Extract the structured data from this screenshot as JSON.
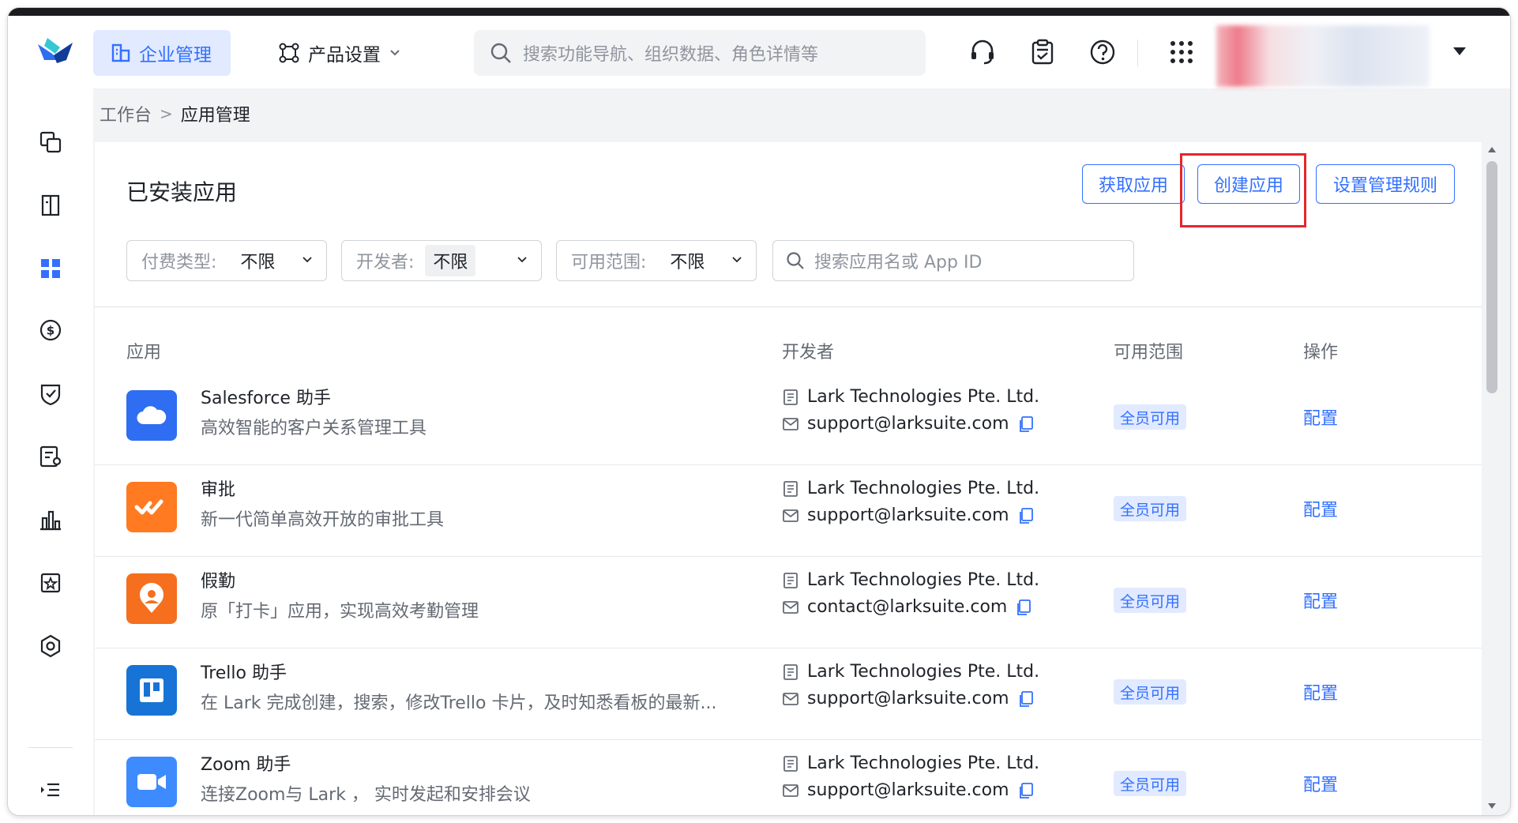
{
  "header": {
    "nav_corp": "企业管理",
    "nav_product": "产品设置",
    "search_placeholder": "搜索功能导航、组织数据、角色详情等"
  },
  "breadcrumb": {
    "home": "工作台",
    "separator": ">",
    "current": "应用管理"
  },
  "page": {
    "title": "已安装应用",
    "buttons": {
      "get_app": "获取应用",
      "create_app": "创建应用",
      "manage_rules": "设置管理规则"
    }
  },
  "filters": {
    "pay_type": {
      "label": "付费类型:",
      "value": "不限"
    },
    "developer": {
      "label": "开发者:",
      "value": "不限"
    },
    "scope": {
      "label": "可用范围:",
      "value": "不限"
    },
    "search_placeholder": "搜索应用名或 App ID"
  },
  "table": {
    "columns": {
      "app": "应用",
      "developer": "开发者",
      "scope": "可用范围",
      "action": "操作"
    },
    "rows": [
      {
        "name": "Salesforce 助手",
        "desc": "高效智能的客户关系管理工具",
        "developer": "Lark Technologies Pte. Ltd.",
        "email": "support@larksuite.com",
        "scope": "全员可用",
        "action": "配置",
        "icon": "cloud-icon",
        "color": "#2f6df2"
      },
      {
        "name": "审批",
        "desc": "新一代简单高效开放的审批工具",
        "developer": "Lark Technologies Pte. Ltd.",
        "email": "support@larksuite.com",
        "scope": "全员可用",
        "action": "配置",
        "icon": "approval-icon",
        "color": "#ff7a20"
      },
      {
        "name": "假勤",
        "desc": "原「打卡」应用，实现高效考勤管理",
        "developer": "Lark Technologies Pte. Ltd.",
        "email": "contact@larksuite.com",
        "scope": "全员可用",
        "action": "配置",
        "icon": "location-pin-icon",
        "color": "#f56f1e"
      },
      {
        "name": "Trello 助手",
        "desc": "在 Lark 完成创建，搜索，修改Trello 卡片，及时知悉看板的最新...",
        "developer": "Lark Technologies Pte. Ltd.",
        "email": "support@larksuite.com",
        "scope": "全员可用",
        "action": "配置",
        "icon": "trello-board-icon",
        "color": "#1774d6"
      },
      {
        "name": "Zoom 助手",
        "desc": "连接Zoom与 Lark ， 实时发起和安排会议",
        "developer": "Lark Technologies Pte. Ltd.",
        "email": "support@larksuite.com",
        "scope": "全员可用",
        "action": "配置",
        "icon": "video-camera-icon",
        "color": "#3d8bff"
      }
    ]
  },
  "colors": {
    "accent": "#3370ff",
    "highlight_box": "#e5262b"
  }
}
